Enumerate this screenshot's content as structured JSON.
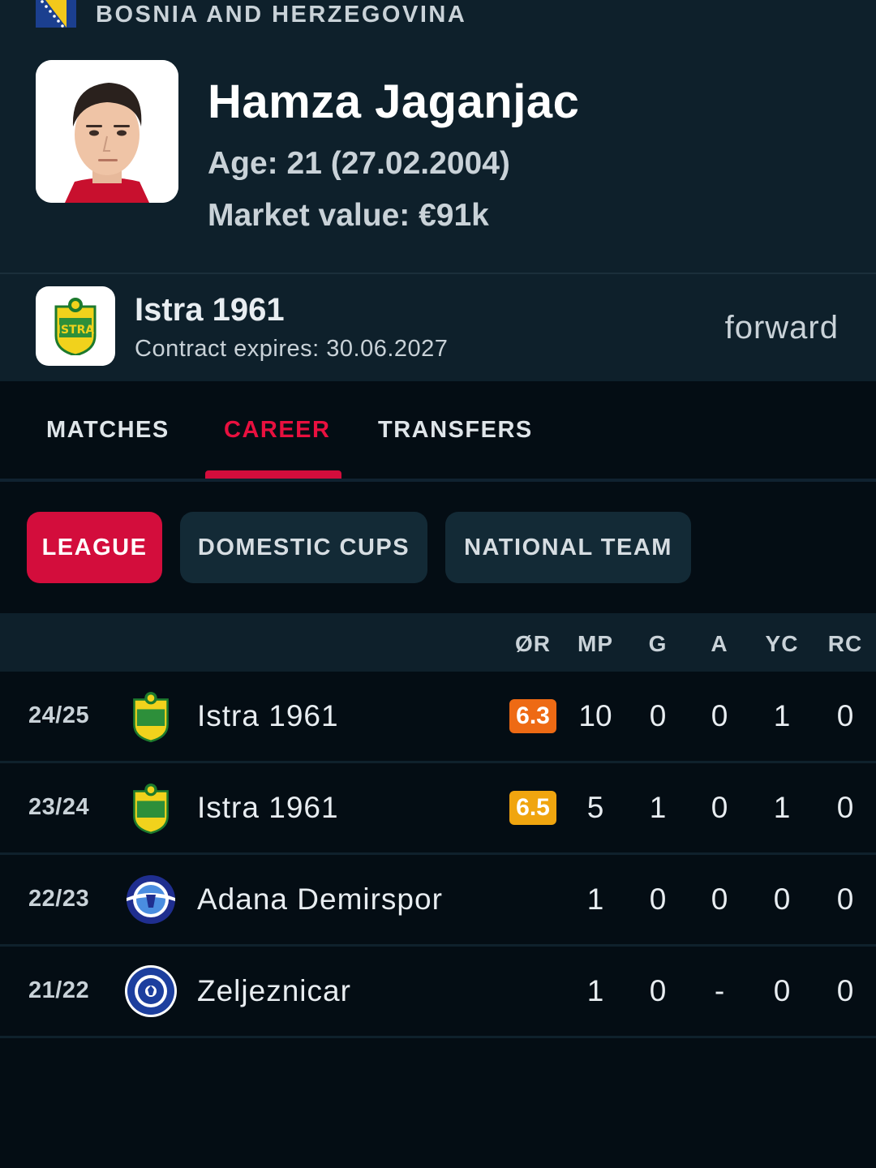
{
  "player": {
    "country": "BOSNIA AND HERZEGOVINA",
    "name": "Hamza Jaganjac",
    "age": "Age: 21 (27.02.2004)",
    "market_value": "Market value: €91k"
  },
  "club": {
    "name": "Istra 1961",
    "contract": "Contract expires: 30.06.2027",
    "position": "forward"
  },
  "tabs": [
    {
      "label": "MATCHES",
      "active": false
    },
    {
      "label": "CAREER",
      "active": true
    },
    {
      "label": "TRANSFERS",
      "active": false
    }
  ],
  "filters": [
    {
      "label": "LEAGUE",
      "active": true
    },
    {
      "label": "DOMESTIC CUPS",
      "active": false
    },
    {
      "label": "NATIONAL TEAM",
      "active": false
    }
  ],
  "table": {
    "columns": [
      "ØR",
      "MP",
      "G",
      "A",
      "YC",
      "RC"
    ],
    "rows": [
      {
        "season": "24/25",
        "team": "Istra 1961",
        "rating": "6.3",
        "mp": "10",
        "g": "0",
        "a": "0",
        "yc": "1",
        "rc": "0"
      },
      {
        "season": "23/24",
        "team": "Istra 1961",
        "rating": "6.5",
        "mp": "5",
        "g": "1",
        "a": "0",
        "yc": "1",
        "rc": "0"
      },
      {
        "season": "22/23",
        "team": "Adana Demirspor",
        "rating": "",
        "mp": "1",
        "g": "0",
        "a": "0",
        "yc": "0",
        "rc": "0"
      },
      {
        "season": "21/22",
        "team": "Zeljeznicar",
        "rating": "",
        "mp": "1",
        "g": "0",
        "a": "-",
        "yc": "0",
        "rc": "0"
      }
    ]
  },
  "colors": {
    "accent": "#d30d3c",
    "rating_orange": "#ee6a14",
    "rating_yellow": "#f0a50f",
    "header_bg": "#0e202b",
    "page_bg": "#040d14"
  }
}
